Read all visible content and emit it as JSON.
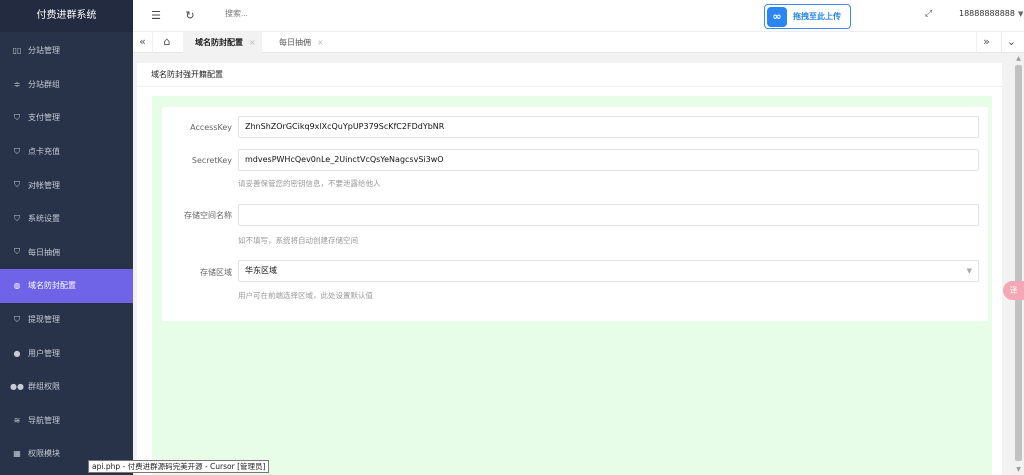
{
  "sidebar": {
    "brand": "付费进群系统",
    "items": [
      {
        "label": "分站管理",
        "icon": "columns-icon"
      },
      {
        "label": "分站群组",
        "icon": "sliders-icon"
      },
      {
        "label": "支付管理",
        "icon": "shield-check-icon"
      },
      {
        "label": "点卡充值",
        "icon": "shield-check-icon"
      },
      {
        "label": "对帐管理",
        "icon": "shield-check-icon"
      },
      {
        "label": "系统设置",
        "icon": "shield-check-icon"
      },
      {
        "label": "每日抽佣",
        "icon": "shield-check-icon"
      },
      {
        "label": "域名防封配置",
        "icon": "globe-icon",
        "active": true
      },
      {
        "label": "提现管理",
        "icon": "shield-check-icon"
      },
      {
        "label": "用户管理",
        "icon": "user-icon"
      },
      {
        "label": "群组权限",
        "icon": "users-icon"
      },
      {
        "label": "导航管理",
        "icon": "layers-icon"
      },
      {
        "label": "权限模块",
        "icon": "grid-icon"
      }
    ]
  },
  "header": {
    "search_placeholder": "搜索...",
    "upload_label": "拖拽至此上传",
    "user": "18888888888"
  },
  "tabs": [
    {
      "label": "域名防封配置",
      "active": true
    },
    {
      "label": "每日抽佣",
      "active": false
    }
  ],
  "card": {
    "title": "域名防封強开籍配置"
  },
  "form": {
    "access_key_label": "AccessKey",
    "access_key_value": "ZhnShZOrGCikq9xlXcQuYpUP379ScKfC2FDdYbNR",
    "secret_key_label": "SecretKey",
    "secret_key_value": "mdvesPWHcQev0nLe_2UinctVcQsYeNagcsvSi3wO",
    "secret_key_help": "请妥善保管您的密钥信息，不要泄露给他人",
    "bucket_label": "存储空间名称",
    "bucket_value": "",
    "bucket_help": "如不填写，系统将自动创建存储空间",
    "region_label": "存储区域",
    "region_value": "华东区域",
    "region_help": "用户可在前端选择区域，此处设置默认值"
  },
  "float_button_label": "译",
  "tooltip": "api.php - 付费进群源码完美开源 - Cursor [管理员]",
  "colors": {
    "sidebar_bg": "#28334a",
    "active_item": "#6f63e8",
    "upload_accent": "#2a86f5",
    "form_area_bg": "#e8fde8"
  }
}
